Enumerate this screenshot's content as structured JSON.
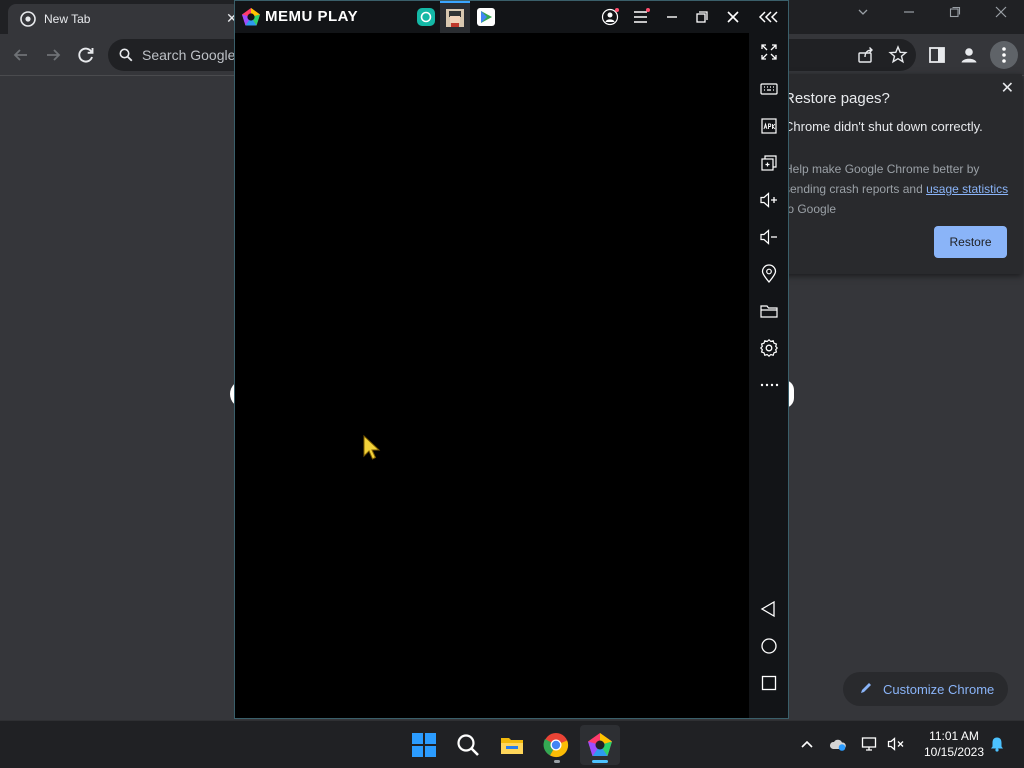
{
  "chrome": {
    "tab_title": "New Tab",
    "tab_close": "✕",
    "search_placeholder": "Search Google or type a URL",
    "restore": {
      "title": "Restore pages?",
      "message": "Chrome didn't shut down correctly.",
      "description_pre": "Help make Google Chrome better by sending crash reports and ",
      "link": "usage statistics",
      "description_post": " to Google",
      "button": "Restore",
      "close": "✕"
    },
    "customize_label": "Customize Chrome"
  },
  "memu": {
    "name": "MEMU PLAY",
    "app_tabs": [
      "app-icon-teal",
      "app-icon-avatar",
      "play-store-icon"
    ],
    "sidebar_icons": [
      "fullscreen-icon",
      "keyboard-icon",
      "apk-icon",
      "multi-instance-icon",
      "volume-up-icon",
      "volume-down-icon",
      "location-icon",
      "folder-icon",
      "settings-icon",
      "more-icon",
      "back-icon",
      "home-icon",
      "recent-apps-icon"
    ]
  },
  "taskbar": {
    "time": "11:01 AM",
    "date": "10/15/2023"
  },
  "colors": {
    "chrome_bg": "#35363a",
    "tabstrip_bg": "#202124",
    "accent": "#8ab4f8",
    "memu_border": "#3a5f6a"
  }
}
